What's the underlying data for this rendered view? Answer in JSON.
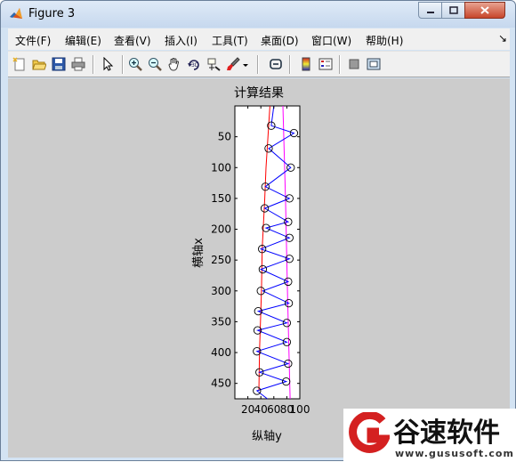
{
  "window": {
    "title": "Figure 3"
  },
  "menu": {
    "items": [
      "文件(F)",
      "编辑(E)",
      "查看(V)",
      "插入(I)",
      "工具(T)",
      "桌面(D)",
      "窗口(W)",
      "帮助(H)"
    ]
  },
  "toolbar": {
    "icons": [
      "new-figure-icon",
      "open-file-icon",
      "save-icon",
      "print-icon",
      "select-arrow-icon",
      "zoom-in-icon",
      "zoom-out-icon",
      "pan-hand-icon",
      "rotate-3d-icon",
      "data-cursor-icon",
      "brush-icon",
      "link-icon",
      "colorbar-icon",
      "legend-icon",
      "hide-plot-tools-icon",
      "show-plot-tools-icon"
    ]
  },
  "chart_data": {
    "type": "line",
    "title": "计算结果",
    "xlabel": "纵轴y",
    "ylabel": "横轴x",
    "xlim": [
      0,
      100
    ],
    "ylim": [
      0,
      475
    ],
    "y_reversed": true,
    "xticks": [
      20,
      40,
      60,
      80,
      100
    ],
    "xtick_labels": [
      "20",
      "40",
      "60",
      "80",
      "100"
    ],
    "yticks": [
      50,
      100,
      150,
      200,
      250,
      300,
      350,
      400,
      450
    ],
    "colors": {
      "red": "#ff0000",
      "blue": "#0000ff",
      "magenta": "#ff00ff",
      "circle": "#000000"
    },
    "series": [
      {
        "color": "red",
        "points": [
          [
            37,
            462
          ],
          [
            38,
            398
          ],
          [
            41,
            300
          ],
          [
            42,
            232
          ],
          [
            46,
            150
          ],
          [
            48,
            100
          ],
          [
            54,
            0
          ]
        ]
      },
      {
        "color": "magenta",
        "points": [
          [
            74,
            0
          ],
          [
            78,
            150
          ],
          [
            81,
            300
          ],
          [
            85,
            475
          ]
        ]
      },
      {
        "color": "blue",
        "points": [
          [
            60,
            0
          ],
          [
            56,
            32
          ],
          [
            91,
            44
          ],
          [
            52,
            69
          ],
          [
            86,
            100
          ],
          [
            47,
            131
          ],
          [
            84,
            150
          ],
          [
            46,
            166
          ],
          [
            82,
            188
          ],
          [
            48,
            198
          ],
          [
            84,
            214
          ],
          [
            40,
            232
          ],
          [
            84,
            248
          ],
          [
            40,
            265
          ],
          [
            82,
            285
          ],
          [
            43,
            300
          ],
          [
            83,
            320
          ],
          [
            36,
            333
          ],
          [
            80,
            352
          ],
          [
            35,
            364
          ],
          [
            80,
            383
          ],
          [
            34,
            398
          ],
          [
            82,
            418
          ],
          [
            38,
            432
          ],
          [
            79,
            447
          ],
          [
            34,
            462
          ],
          [
            50,
            475
          ]
        ]
      },
      {
        "color": "circle",
        "markers": "circle",
        "points": [
          [
            56,
            32
          ],
          [
            52,
            69
          ],
          [
            47,
            131
          ],
          [
            46,
            166
          ],
          [
            48,
            198
          ],
          [
            42,
            232
          ],
          [
            43,
            265
          ],
          [
            40,
            300
          ],
          [
            36,
            333
          ],
          [
            35,
            364
          ],
          [
            34,
            398
          ],
          [
            38,
            432
          ],
          [
            34,
            462
          ],
          [
            91,
            44
          ],
          [
            86,
            100
          ],
          [
            84,
            150
          ],
          [
            82,
            188
          ],
          [
            84,
            214
          ],
          [
            84,
            248
          ],
          [
            82,
            285
          ],
          [
            83,
            320
          ],
          [
            80,
            352
          ],
          [
            80,
            383
          ],
          [
            82,
            418
          ],
          [
            79,
            447
          ]
        ]
      }
    ]
  },
  "watermark": {
    "brand_text": "谷速软件",
    "url": "www.gususoft.com"
  }
}
